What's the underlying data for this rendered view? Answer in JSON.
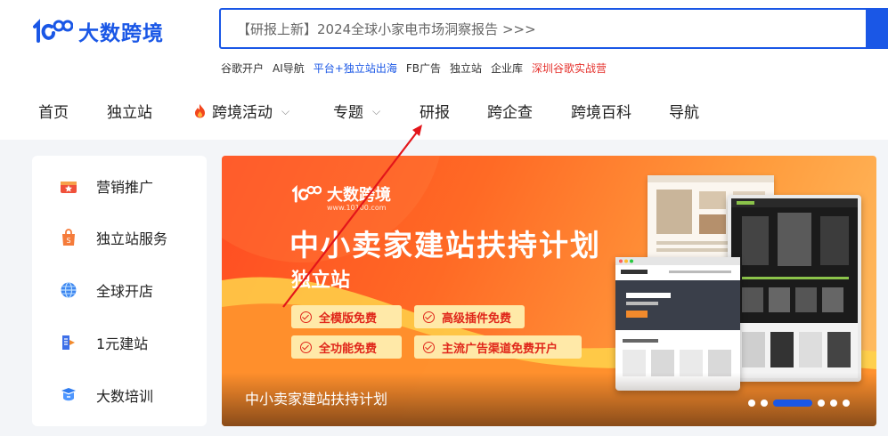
{
  "header": {
    "logo_text": "大数跨境",
    "search_text": "【研报上新】2024全球小家电市场洞察报告 >>>",
    "hot_links": [
      {
        "label": "谷歌开户",
        "style": "normal"
      },
      {
        "label": "AI导航",
        "style": "normal"
      },
      {
        "label": "平台+独立站出海",
        "style": "blue"
      },
      {
        "label": "FB广告",
        "style": "normal"
      },
      {
        "label": "独立站",
        "style": "normal"
      },
      {
        "label": "企业库",
        "style": "normal"
      },
      {
        "label": "深圳谷歌实战营",
        "style": "red"
      }
    ]
  },
  "nav": {
    "items": [
      "首页",
      "独立站",
      "跨境活动",
      "专题",
      "研报",
      "跨企查",
      "跨境百科",
      "导航"
    ]
  },
  "sidebar": {
    "items": [
      {
        "label": "营销推广",
        "icon": "megaphone-icon"
      },
      {
        "label": "独立站服务",
        "icon": "shopping-bag-icon"
      },
      {
        "label": "全球开店",
        "icon": "globe-icon"
      },
      {
        "label": "1元建站",
        "icon": "site-build-icon"
      },
      {
        "label": "大数培训",
        "icon": "training-icon"
      }
    ]
  },
  "banner": {
    "logo_text": "大数跨境",
    "logo_url": "www.10100.com",
    "title": "中小卖家建站扶持计划",
    "subtitle": "独立站",
    "features": [
      "全模版免费",
      "高级插件免费",
      "全功能免费",
      "主流广告渠道免费开户"
    ],
    "caption": "中小卖家建站扶持计划",
    "slide_count": 6,
    "active_slide": 3
  },
  "colors": {
    "brand_blue": "#1a57e6",
    "accent_red": "#e5322d",
    "banner_orange": "#ff6a25"
  }
}
